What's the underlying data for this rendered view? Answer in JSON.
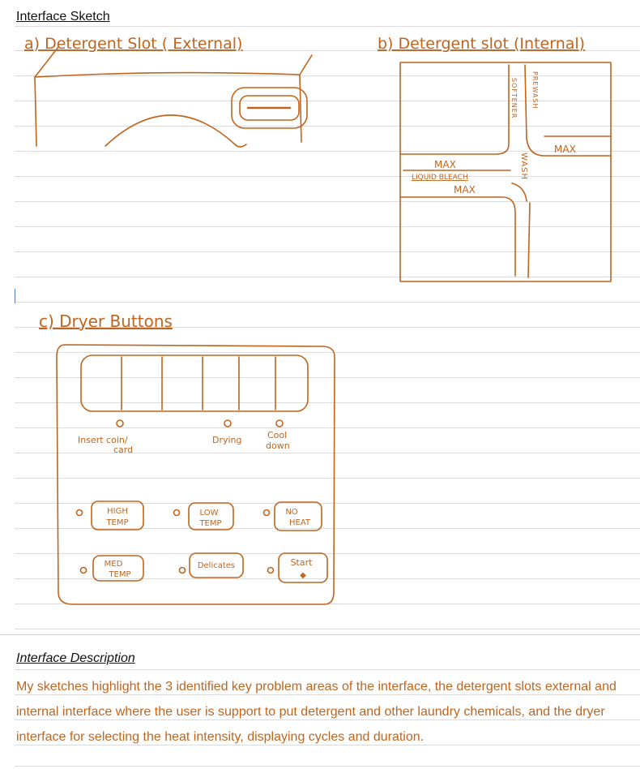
{
  "page": {
    "heading": "Interface Sketch",
    "description_heading": "Interface Description",
    "description_body": "My sketches highlight the 3 identified key problem areas of the interface, the detergent slots external and internal interface where the user is support to put detergent and other laundry chemicals, and the dryer interface for selecting the heat intensity, displaying cycles and duration."
  },
  "sketch_a": {
    "title": "a) Detergent Slot ( External)"
  },
  "sketch_b": {
    "title": "b) Detergent slot (Internal)",
    "labels": {
      "softener": "SOFTENER",
      "prewash": "PREWASH",
      "max_left": "MAX",
      "liquid_bleach": "LIQUID BLEACH",
      "max_under_bleach": "MAX",
      "wash": "WASH",
      "max_right": "MAX"
    }
  },
  "sketch_c": {
    "title": "c) Dryer Buttons",
    "status_labels": {
      "insert_coin_line1": "Insert coin/",
      "insert_coin_line2": "card",
      "drying": "Drying",
      "cool_line1": "Cool",
      "cool_line2": "down"
    },
    "buttons": {
      "high_line1": "HIGH",
      "high_line2": "TEMP",
      "low_line1": "LOW",
      "low_line2": "TEMP",
      "noheat_line1": "NO",
      "noheat_line2": "HEAT",
      "med_line1": "MED",
      "med_line2": "TEMP",
      "delicate": "Delicates",
      "start": "Start"
    }
  },
  "colors": {
    "ink": "#c0651f",
    "text": "#111111",
    "rule": "#dcdcdc"
  }
}
